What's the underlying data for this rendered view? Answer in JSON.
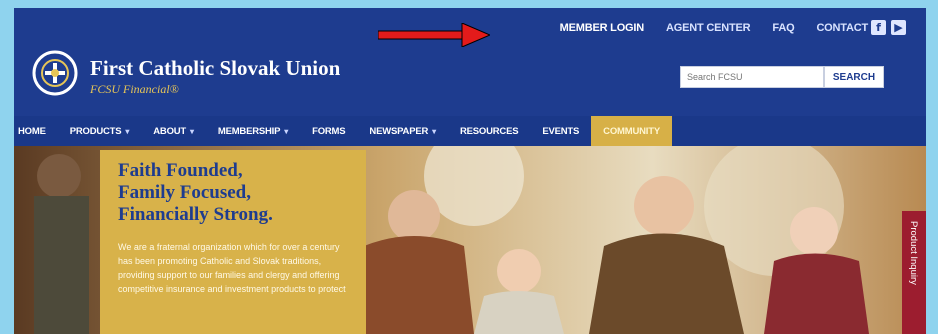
{
  "utility_nav": [
    "MEMBER LOGIN",
    "AGENT CENTER",
    "FAQ",
    "CONTACT"
  ],
  "social": [
    {
      "icon": "facebook-icon",
      "glyph": "f"
    },
    {
      "icon": "youtube-icon",
      "glyph": "▶"
    }
  ],
  "brand": {
    "name": "First Catholic Slovak Union",
    "subtitle": "FCSU Financial®"
  },
  "search": {
    "placeholder": "Search FCSU",
    "button": "SEARCH"
  },
  "main_nav": [
    {
      "label": "HOME",
      "caret": false
    },
    {
      "label": "PRODUCTS",
      "caret": true
    },
    {
      "label": "ABOUT",
      "caret": true
    },
    {
      "label": "MEMBERSHIP",
      "caret": true
    },
    {
      "label": "FORMS",
      "caret": false
    },
    {
      "label": "NEWSPAPER",
      "caret": true
    },
    {
      "label": "RESOURCES",
      "caret": false
    },
    {
      "label": "EVENTS",
      "caret": false
    },
    {
      "label": "COMMUNITY",
      "caret": false,
      "highlight": true
    }
  ],
  "hero": {
    "headline": [
      "Faith Founded,",
      "Family Focused,",
      "Financially Strong."
    ],
    "body": "We are a fraternal organization which for over a century has been promoting Catholic and Slovak traditions, providing support to our families and clergy and offering competitive insurance and investment products to protect"
  },
  "side_tab": "Product Inquiry",
  "colors": {
    "primary": "#1e3c8f",
    "gold": "#d8b24a",
    "tab": "#9c1d2f",
    "arrow": "#e31b1b"
  }
}
